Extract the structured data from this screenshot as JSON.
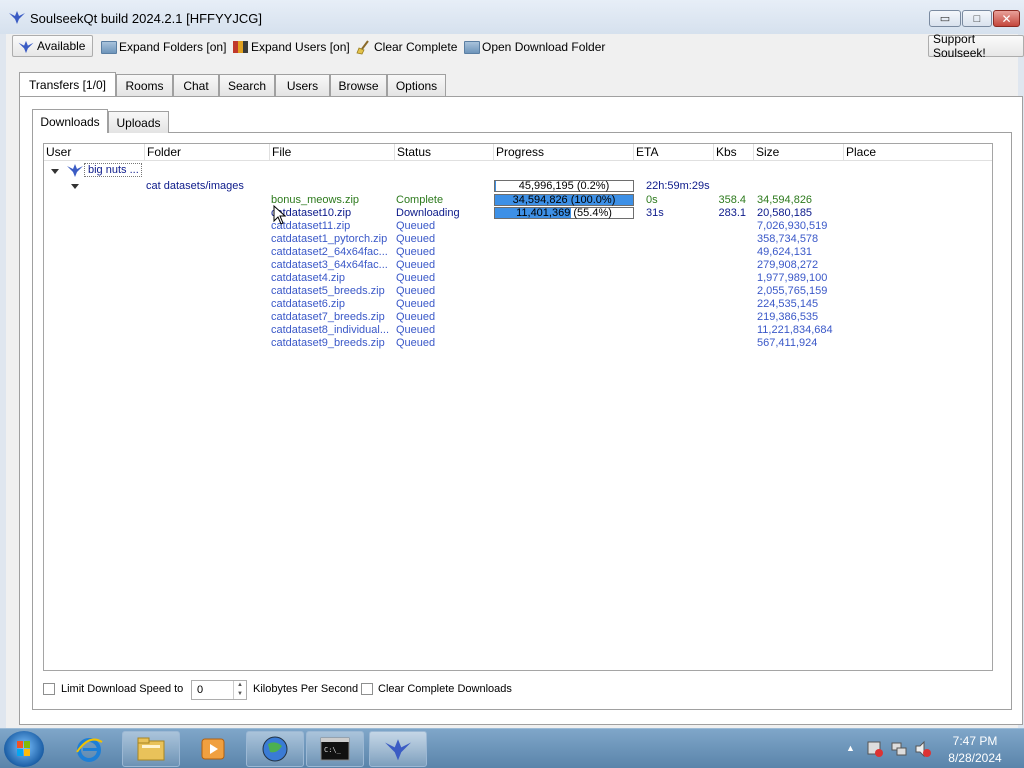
{
  "window": {
    "title": "SoulseekQt build 2024.2.1 [HFFYYJCG]",
    "min_glyph": "▭",
    "max_glyph": "□",
    "close_glyph": "✕"
  },
  "toolbar": {
    "available_label": "Available",
    "expand_folders_label": "Expand Folders [on]",
    "expand_users_label": "Expand Users [on]",
    "clear_complete_label": "Clear Complete",
    "open_download_folder_label": "Open Download Folder",
    "support_label": "Support Soulseek!"
  },
  "tabs": [
    {
      "label": "Transfers [1/0]",
      "active": true
    },
    {
      "label": "Rooms"
    },
    {
      "label": "Chat"
    },
    {
      "label": "Search"
    },
    {
      "label": "Users"
    },
    {
      "label": "Browse"
    },
    {
      "label": "Options"
    }
  ],
  "subtabs": [
    {
      "label": "Downloads",
      "active": true
    },
    {
      "label": "Uploads"
    }
  ],
  "columns": [
    "User",
    "Folder",
    "File",
    "Status",
    "Progress",
    "ETA",
    "Kbs",
    "Size",
    "Place"
  ],
  "tree": {
    "user": "big nuts ...",
    "folder": "cat datasets/images",
    "folder_progress": {
      "text": "45,996,195 (0.2%)",
      "fraction": 0.002
    },
    "folder_eta": "22h:59m:29s",
    "files": [
      {
        "file": "bonus_meows.zip",
        "status": "Complete",
        "progress_text": "34,594,826 (100.0%)",
        "fraction": 1.0,
        "eta": "0s",
        "kbs": "358.4",
        "size": "34,594,826",
        "state": "done"
      },
      {
        "file": "catdataset10.zip",
        "status": "Downloading",
        "progress_text": "11,401,369 (55.4%)",
        "fraction": 0.554,
        "eta": "31s",
        "kbs": "283.1",
        "size": "20,580,185",
        "state": "dl"
      },
      {
        "file": "catdataset11.zip",
        "status": "Queued",
        "size": "7,026,930,519",
        "state": "queued"
      },
      {
        "file": "catdataset1_pytorch.zip",
        "status": "Queued",
        "size": "358,734,578",
        "state": "queued"
      },
      {
        "file": "catdataset2_64x64fac...",
        "status": "Queued",
        "size": "49,624,131",
        "state": "queued"
      },
      {
        "file": "catdataset3_64x64fac...",
        "status": "Queued",
        "size": "279,908,272",
        "state": "queued"
      },
      {
        "file": "catdataset4.zip",
        "status": "Queued",
        "size": "1,977,989,100",
        "state": "queued"
      },
      {
        "file": "catdataset5_breeds.zip",
        "status": "Queued",
        "size": "2,055,765,159",
        "state": "queued"
      },
      {
        "file": "catdataset6.zip",
        "status": "Queued",
        "size": "224,535,145",
        "state": "queued"
      },
      {
        "file": "catdataset7_breeds.zip",
        "status": "Queued",
        "size": "219,386,535",
        "state": "queued"
      },
      {
        "file": "catdataset8_individual...",
        "status": "Queued",
        "size": "11,221,834,684",
        "state": "queued"
      },
      {
        "file": "catdataset9_breeds.zip",
        "status": "Queued",
        "size": "567,411,924",
        "state": "queued"
      }
    ]
  },
  "bottom": {
    "limit_speed_label": "Limit Download Speed to",
    "speed_value": "0",
    "kbps_label": "Kilobytes Per Second",
    "clear_complete_downloads_label": "Clear Complete Downloads"
  },
  "taskbar": {
    "time": "7:47 PM",
    "date": "8/28/2024"
  },
  "colors": {
    "progress_fill": "#3d90e6",
    "queued": "#3a58c8",
    "complete": "#2d7a1d",
    "downloading": "#0c1a8a"
  }
}
